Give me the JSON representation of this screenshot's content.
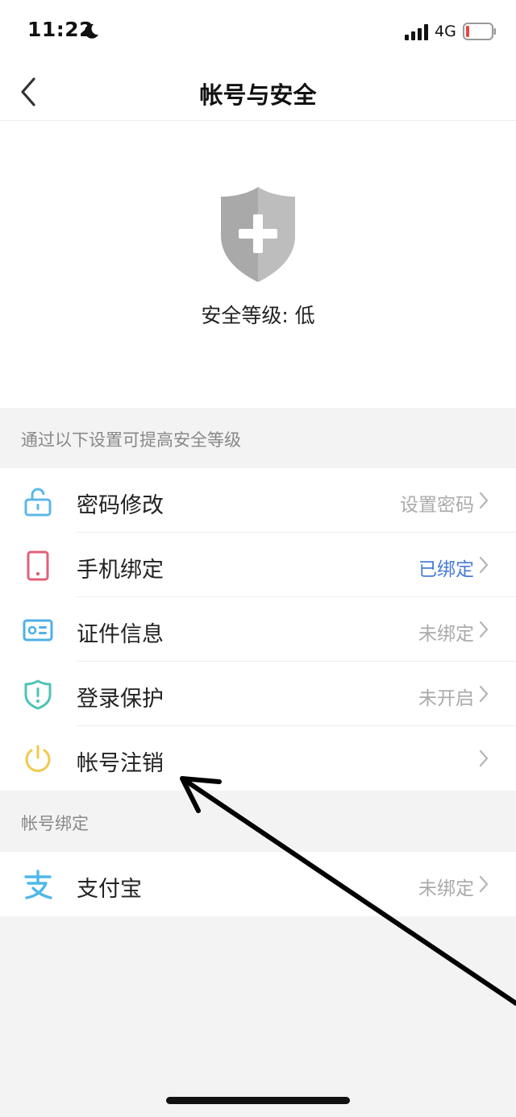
{
  "status_bar": {
    "time": "11:22",
    "network": "4G"
  },
  "nav": {
    "title": "帐号与安全"
  },
  "security": {
    "level_text": "安全等级: 低"
  },
  "sections": {
    "improve_header": "通过以下设置可提高安全等级",
    "binding_header": "帐号绑定"
  },
  "security_items": [
    {
      "icon": "lock-icon",
      "label": "密码修改",
      "value": "设置密码"
    },
    {
      "icon": "phone-icon",
      "label": "手机绑定",
      "value": "已绑定"
    },
    {
      "icon": "id-card-icon",
      "label": "证件信息",
      "value": "未绑定"
    },
    {
      "icon": "shield-alert-icon",
      "label": "登录保护",
      "value": "未开启"
    },
    {
      "icon": "power-icon",
      "label": "帐号注销",
      "value": ""
    }
  ],
  "binding_items": [
    {
      "icon": "alipay-icon",
      "label": "支付宝",
      "value": "未绑定"
    }
  ],
  "colors": {
    "bound_value": "#4a7bd6",
    "muted_value": "#aaaaaa",
    "lock_icon": "#5db8e8",
    "phone_icon": "#e0607a",
    "id_icon": "#4fb0e8",
    "shield_icon": "#4fc3b5",
    "power_icon": "#f2c94c",
    "alipay_icon": "#4fb8e8"
  }
}
